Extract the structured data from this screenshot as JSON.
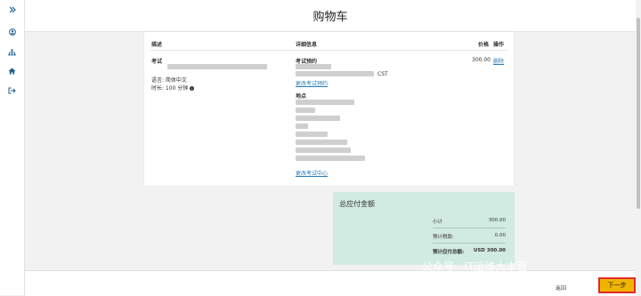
{
  "page": {
    "title": "购物车"
  },
  "table": {
    "headers": {
      "description": "描述",
      "details": "详细信息",
      "price": "价格",
      "action": "操作"
    },
    "item": {
      "label": "考试",
      "language": "语言: 简体中文",
      "duration": "时长: 100 分钟",
      "appointment_label": "考试预约",
      "time_suffix": "CST",
      "change_appointment": "更改考试预约",
      "location_label": "地点",
      "change_center": "更改考试中心",
      "price": "300.00",
      "delete": "删除"
    }
  },
  "summary": {
    "title": "总应付金额",
    "subtotal_label": "小计",
    "subtotal_value": "300.00",
    "tax_label": "预计税款:",
    "tax_value": "0.00",
    "total_label": "预计应付总额:",
    "total_value": "USD 300.00"
  },
  "actions": {
    "back": "返回",
    "next": "下一步"
  },
  "watermark": {
    "line1": "公众号 · IT运维大本营",
    "line2": "CSDN @IT运维大本营"
  },
  "icons": [
    "expand-icon",
    "user-icon",
    "sitemap-icon",
    "home-icon",
    "logout-icon"
  ],
  "colors": {
    "accent": "#1d5f91",
    "summary_bg": "#d2ebe2",
    "next_button": "#f0b400",
    "link": "#2a7bb8"
  }
}
